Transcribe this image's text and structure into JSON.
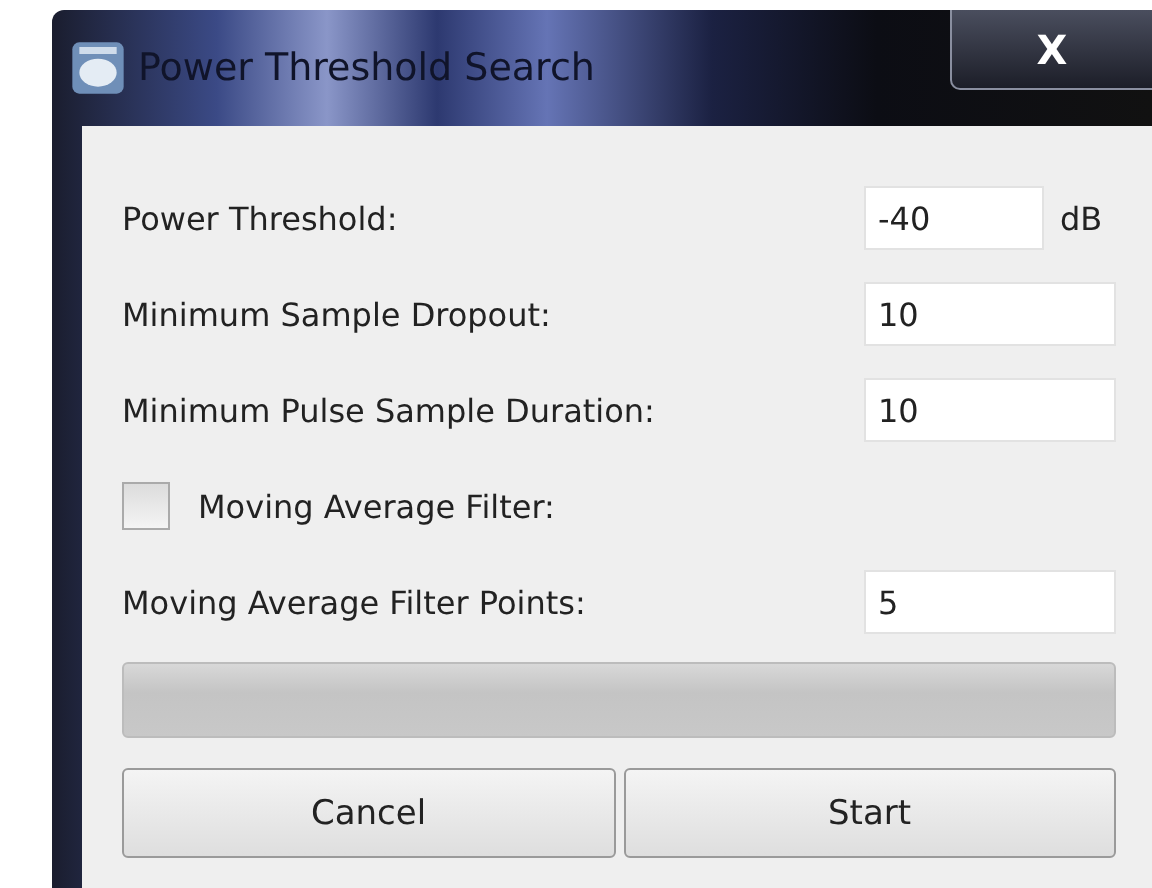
{
  "window": {
    "title": "Power Threshold Search",
    "close": "X"
  },
  "fields": [
    {
      "kind": "input",
      "label": "Power Threshold:",
      "value": "-40",
      "unit": "dB"
    },
    {
      "kind": "input",
      "label": "Minimum Sample Dropout:",
      "value": "10"
    },
    {
      "kind": "input",
      "label": "Minimum Pulse Sample Duration:",
      "value": "10"
    },
    {
      "kind": "checkbox",
      "label": "Moving Average Filter:",
      "checked": false
    },
    {
      "kind": "input",
      "label": "Moving Average Filter Points:",
      "value": "5"
    }
  ],
  "buttons": [
    "Cancel",
    "Start"
  ]
}
